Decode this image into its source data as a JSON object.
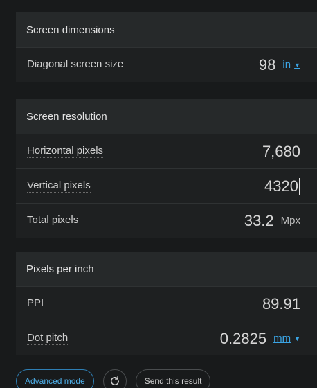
{
  "screen_dimensions": {
    "title": "Screen dimensions",
    "diagonal": {
      "label": "Diagonal screen size",
      "value": "98",
      "unit": "in"
    }
  },
  "screen_resolution": {
    "title": "Screen resolution",
    "horizontal": {
      "label": "Horizontal pixels",
      "value": "7,680"
    },
    "vertical": {
      "label": "Vertical pixels",
      "value": "4320"
    },
    "total": {
      "label": "Total pixels",
      "value": "33.2",
      "unit": "Mpx"
    }
  },
  "pixels_per_inch": {
    "title": "Pixels per inch",
    "ppi": {
      "label": "PPI",
      "value": "89.91"
    },
    "dot_pitch": {
      "label": "Dot pitch",
      "value": "0.2825",
      "unit": "mm"
    }
  },
  "actions": {
    "advanced_mode": "Advanced mode",
    "reload_icon": "reload-icon",
    "send_result": "Send this result"
  },
  "colors": {
    "accent": "#3aa4e4",
    "background": "#181a1b",
    "card_header": "#26292a",
    "row": "#1e2021"
  }
}
